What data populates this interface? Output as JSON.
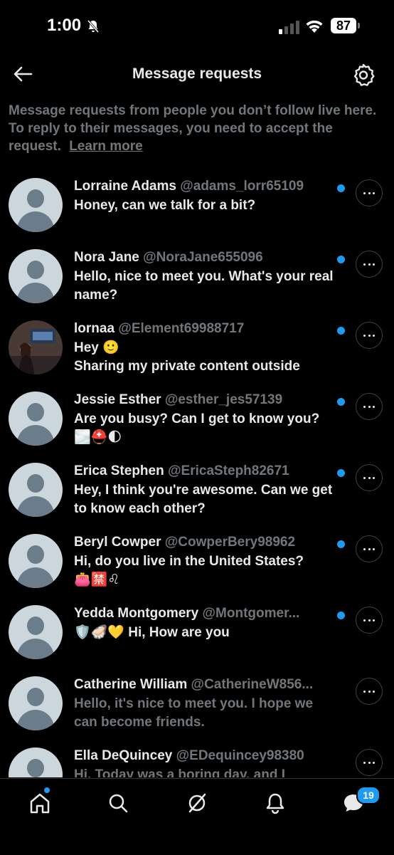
{
  "status_bar": {
    "time": "1:00",
    "battery": "87"
  },
  "header": {
    "title": "Message requests"
  },
  "notice": {
    "text": "Message requests from people you don’t follow live here. To reply to their messages, you need to accept the request.",
    "link": "Learn more"
  },
  "requests": [
    {
      "name": "Lorraine Adams",
      "handle": "@adams_lorr65109",
      "message": "Honey, can we talk for a bit?",
      "unread": true
    },
    {
      "name": "Nora Jane",
      "handle": "@NoraJane655096",
      "message": "Hello, nice to meet you. What's your real name?",
      "unread": true
    },
    {
      "name": "lornaa",
      "handle": "@Element69988717",
      "message_line1": "Hey 🙂",
      "message_line2": "Sharing my private content outside",
      "unread": true
    },
    {
      "name": "Jessie Esther",
      "handle": "@esther_jes57139",
      "message_line1": "Are you busy? Can I get to know you?",
      "message_line2": "🌫️⛑️🌓",
      "unread": true
    },
    {
      "name": "Erica Stephen",
      "handle": "@EricaSteph82671",
      "message": "Hey, I think you're awesome. Can we get to know each other?",
      "unread": true
    },
    {
      "name": "Beryl Cowper",
      "handle": "@CowperBery98962",
      "message_line1": "Hi, do you live in the United States?",
      "message_line2": "👛🈲♌",
      "unread": true
    },
    {
      "name": "Yedda Montgomery",
      "handle": "@Montgomer...",
      "message": "🛡️🦪💛 Hi, How are you",
      "unread": true
    },
    {
      "name": "Catherine William",
      "handle": "@CatherineW856...",
      "message": "Hello, it's nice to meet you. I hope we can become friends.",
      "unread": false
    },
    {
      "name": "Ella DeQuincey",
      "handle": "@EDequincey98380",
      "message": "Hi. Today was a boring day, and I",
      "unread": false
    }
  ],
  "tabbar": {
    "messages_badge": "19"
  },
  "colors": {
    "accent": "#1d9bf0",
    "background": "#000000",
    "secondary_text": "#71767b"
  }
}
